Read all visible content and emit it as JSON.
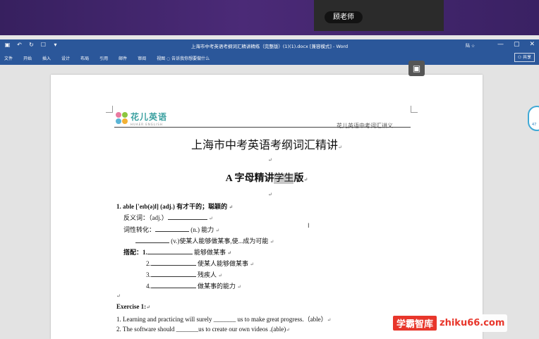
{
  "presenter": {
    "teacher_label": "顾老师"
  },
  "titlebar": {
    "document_title": "上海市中考英语考纲词汇精讲精练（完整版）(1)(1).docx [兼容模式] - Word",
    "user": "陆 ☆",
    "controls": [
      "—",
      "▢",
      "✕"
    ]
  },
  "ribbon": {
    "tabs": [
      "文件",
      "开始",
      "插入",
      "设计",
      "布局",
      "引用",
      "邮件",
      "审阅",
      "视图"
    ],
    "tell_me": "告诉我你想要做什么",
    "share": "共享"
  },
  "document": {
    "logo_text": "花儿英语",
    "logo_sub": "HUAER ENGLISH",
    "header_right": "花儿英语中考词汇讲义",
    "title": "上海市中考英语考纲词汇精讲",
    "subtitle_pre": "A 字母精讲",
    "subtitle_hl": "学生",
    "subtitle_post": "版",
    "entry1_head": "1.   able ['eɪb(ə)l] (adj.)  有才干的；聪颖的",
    "antonym_label": "反义词：（adj.）",
    "conversion_label": "词性转化：",
    "conv_n": "(n.)  能力",
    "conv_v": "(v.)使某人能够做某事,使...成为可能",
    "collocation_label": "搭配：1.",
    "coll1": "能够做某事",
    "coll2_num": "2.",
    "coll2": "使某人能够做某事",
    "coll3_num": "3.",
    "coll3": "残疾人",
    "coll4_num": "4.",
    "coll4": "做某事的能力",
    "exercise_title": "Exercise 1:",
    "ex1": "1. Learning and practicing will surely _______ us to make great progress.（able）",
    "ex2": "2. The software should _______us to create our own videos .(able)"
  },
  "watermark": {
    "badge": "学霸智库",
    "url": "zhiku66.com"
  },
  "widget": {
    "label": "47"
  },
  "colors": {
    "word_blue": "#2b579a",
    "band_purple": "#4b2a77",
    "watermark_red": "#e8362b"
  }
}
